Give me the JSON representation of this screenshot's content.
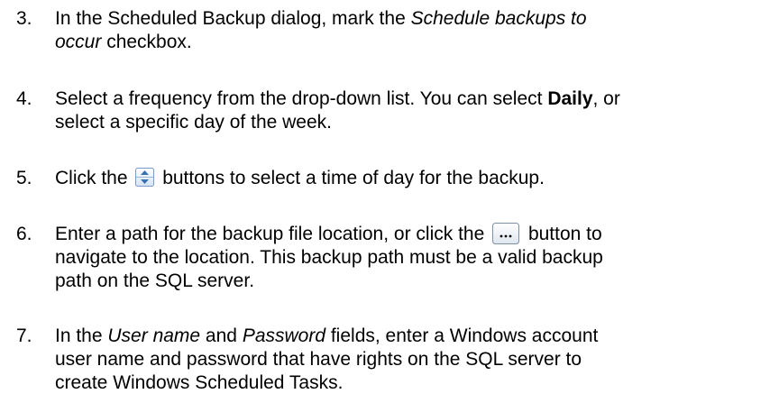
{
  "steps": [
    {
      "number": "3.",
      "line1_a": "In the Scheduled Backup dialog, mark the ",
      "line1_em": "Schedule backups to",
      "line2_em": "occur",
      "line2_b": " checkbox."
    },
    {
      "number": "4.",
      "line1_a": "Select a frequency from the drop-down list. You can select ",
      "line1_strong": "Daily",
      "line1_b": ", or",
      "line2": "select a specific day of the week."
    },
    {
      "number": "5.",
      "before_icon": "Click the ",
      "icon": "spin-arrows-icon",
      "after_icon": " buttons to select a time of day for the backup."
    },
    {
      "number": "6.",
      "line1_a": "Enter a path for the backup file location, or click the ",
      "icon": "browse-ellipsis-icon",
      "line1_b": " button to",
      "line2": "navigate to the location. This backup path must be a valid backup",
      "line3": "path on the SQL server."
    },
    {
      "number": "7.",
      "line1_a": "In the ",
      "line1_em1": "User name",
      "line1_b": " and ",
      "line1_em2": "Password",
      "line1_c": " fields, enter a Windows account",
      "line2": "user name and password that have rights on the SQL server to",
      "line3": "create Windows Scheduled Tasks."
    }
  ],
  "colors": {
    "text": "#000000",
    "icon_border": "#7a9cc6",
    "icon_fill_top": "#ffffff",
    "icon_fill_bottom": "#d6e4f5",
    "icon_arrow": "#3a6fb0"
  }
}
